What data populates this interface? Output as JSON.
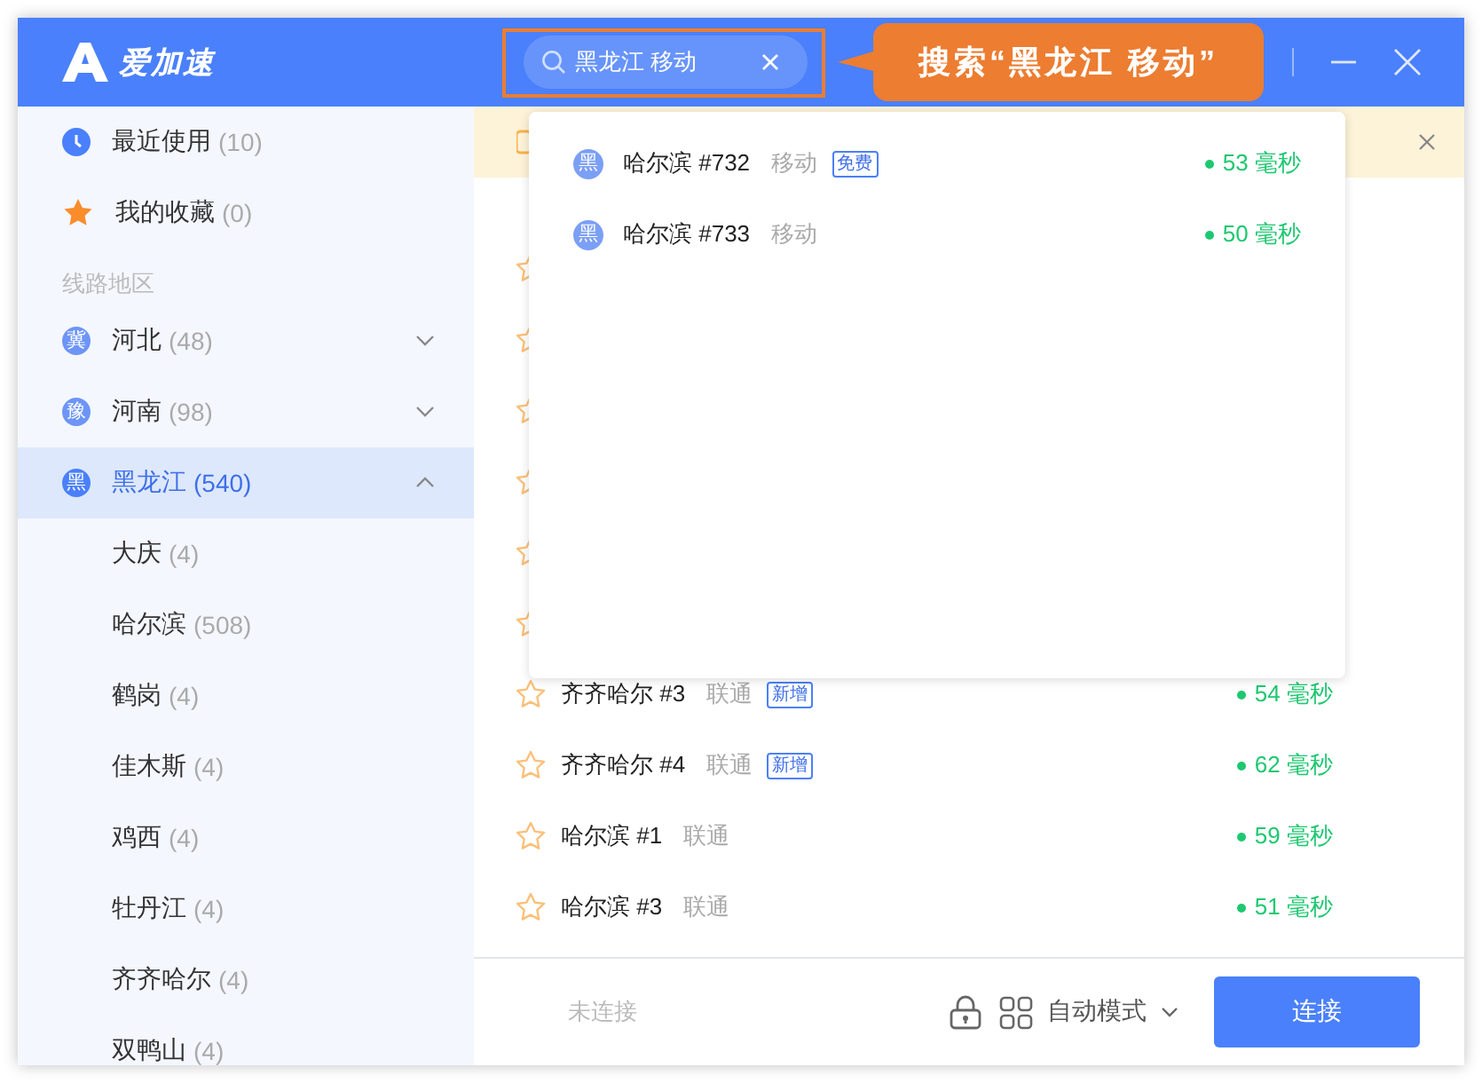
{
  "app": {
    "name": "爱加速"
  },
  "search": {
    "value": "黑龙江 移动"
  },
  "annotation": {
    "text": "搜索“黑龙江  移动”"
  },
  "sidebar": {
    "pinned": [
      {
        "kind": "recent",
        "label": "最近使用",
        "count": "(10)"
      },
      {
        "kind": "favorites",
        "label": "我的收藏",
        "count": "(0)"
      }
    ],
    "section_title": "线路地区",
    "regions": [
      {
        "badge": "冀",
        "label": "河北",
        "count": "(48)",
        "expanded": false,
        "selected": false
      },
      {
        "badge": "豫",
        "label": "河南",
        "count": "(98)",
        "expanded": false,
        "selected": false
      },
      {
        "badge": "黑",
        "label": "黑龙江",
        "count": "(540)",
        "expanded": true,
        "selected": true,
        "children": [
          {
            "label": "大庆",
            "count": "(4)"
          },
          {
            "label": "哈尔滨",
            "count": "(508)"
          },
          {
            "label": "鹤岗",
            "count": "(4)"
          },
          {
            "label": "佳木斯",
            "count": "(4)"
          },
          {
            "label": "鸡西",
            "count": "(4)"
          },
          {
            "label": "牡丹江",
            "count": "(4)"
          },
          {
            "label": "齐齐哈尔",
            "count": "(4)"
          },
          {
            "label": "双鸭山",
            "count": "(4)"
          }
        ]
      }
    ]
  },
  "servers": [
    {
      "favorite": false
    },
    {
      "favorite": false
    },
    {
      "favorite": false
    },
    {
      "favorite": false
    },
    {
      "favorite": false
    },
    {
      "favorite": false
    },
    {
      "favorite": false,
      "name": "齐齐哈尔 #3",
      "carrier": "联通",
      "tag": "新增",
      "latency": "54 毫秒"
    },
    {
      "favorite": false,
      "name": "齐齐哈尔 #4",
      "carrier": "联通",
      "tag": "新增",
      "latency": "62 毫秒"
    },
    {
      "favorite": false,
      "name": "哈尔滨 #1",
      "carrier": "联通",
      "latency": "59 毫秒"
    },
    {
      "favorite": false,
      "name": "哈尔滨 #3",
      "carrier": "联通",
      "latency": "51 毫秒"
    }
  ],
  "dropdown": {
    "results": [
      {
        "badge": "黑",
        "name": "哈尔滨 #732",
        "carrier": "移动",
        "tag": "免费",
        "latency": "53 毫秒"
      },
      {
        "badge": "黑",
        "name": "哈尔滨 #733",
        "carrier": "移动",
        "latency": "50 毫秒"
      }
    ]
  },
  "footer": {
    "status": "未连接",
    "mode": "自动模式",
    "connect": "连接"
  }
}
